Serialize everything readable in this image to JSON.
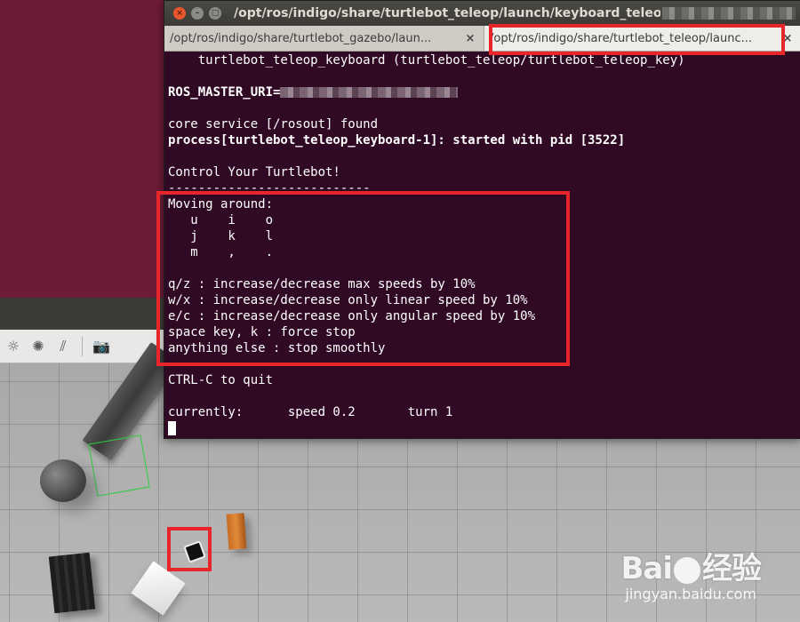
{
  "window": {
    "title": "/opt/ros/indigo/share/turtlebot_teleop/launch/keyboard_teleop.l",
    "close_icon": "×",
    "minimize_icon": "–",
    "maximize_icon": "□"
  },
  "tabs": [
    {
      "label": "/opt/ros/indigo/share/turtlebot_gazebo/laun...",
      "close": "×"
    },
    {
      "label": "/opt/ros/indigo/share/turtlebot_teleop/launc...",
      "close": "×"
    }
  ],
  "terminal": {
    "lines": [
      {
        "text": "    turtlebot_teleop_keyboard (turtlebot_teleop/turtlebot_teleop_key)",
        "bold": false
      },
      {
        "text": "",
        "bold": false
      },
      {
        "text": "ROS_MASTER_URI=",
        "bold": true
      },
      {
        "text": "",
        "bold": false
      },
      {
        "text": "core service [/rosout] found",
        "bold": false
      },
      {
        "text": "process[turtlebot_teleop_keyboard-1]: started with pid [3522]",
        "bold": true
      },
      {
        "text": "",
        "bold": false
      },
      {
        "text": "Control Your Turtlebot!",
        "bold": false
      },
      {
        "text": "---------------------------",
        "bold": false
      },
      {
        "text": "Moving around:",
        "bold": false
      },
      {
        "text": "   u    i    o",
        "bold": false
      },
      {
        "text": "   j    k    l",
        "bold": false
      },
      {
        "text": "   m    ,    .",
        "bold": false
      },
      {
        "text": "",
        "bold": false
      },
      {
        "text": "q/z : increase/decrease max speeds by 10%",
        "bold": false
      },
      {
        "text": "w/x : increase/decrease only linear speed by 10%",
        "bold": false
      },
      {
        "text": "e/c : increase/decrease only angular speed by 10%",
        "bold": false
      },
      {
        "text": "space key, k : force stop",
        "bold": false
      },
      {
        "text": "anything else : stop smoothly",
        "bold": false
      },
      {
        "text": "",
        "bold": false
      },
      {
        "text": "CTRL-C to quit",
        "bold": false
      },
      {
        "text": "",
        "bold": false
      },
      {
        "text": "currently:      speed 0.2       turn 1",
        "bold": false
      }
    ]
  },
  "gazebo": {
    "tools": [
      "sun-icon",
      "spot-light-icon",
      "directional-light-icon",
      "camera-icon"
    ]
  },
  "watermark": {
    "logo_left": "Bai",
    "logo_right": "经验",
    "url": "jingyan.baidu.com"
  },
  "colors": {
    "terminal_bg": "#300a24",
    "annotation": "#e8262a",
    "desktop": "#6d1b36"
  }
}
